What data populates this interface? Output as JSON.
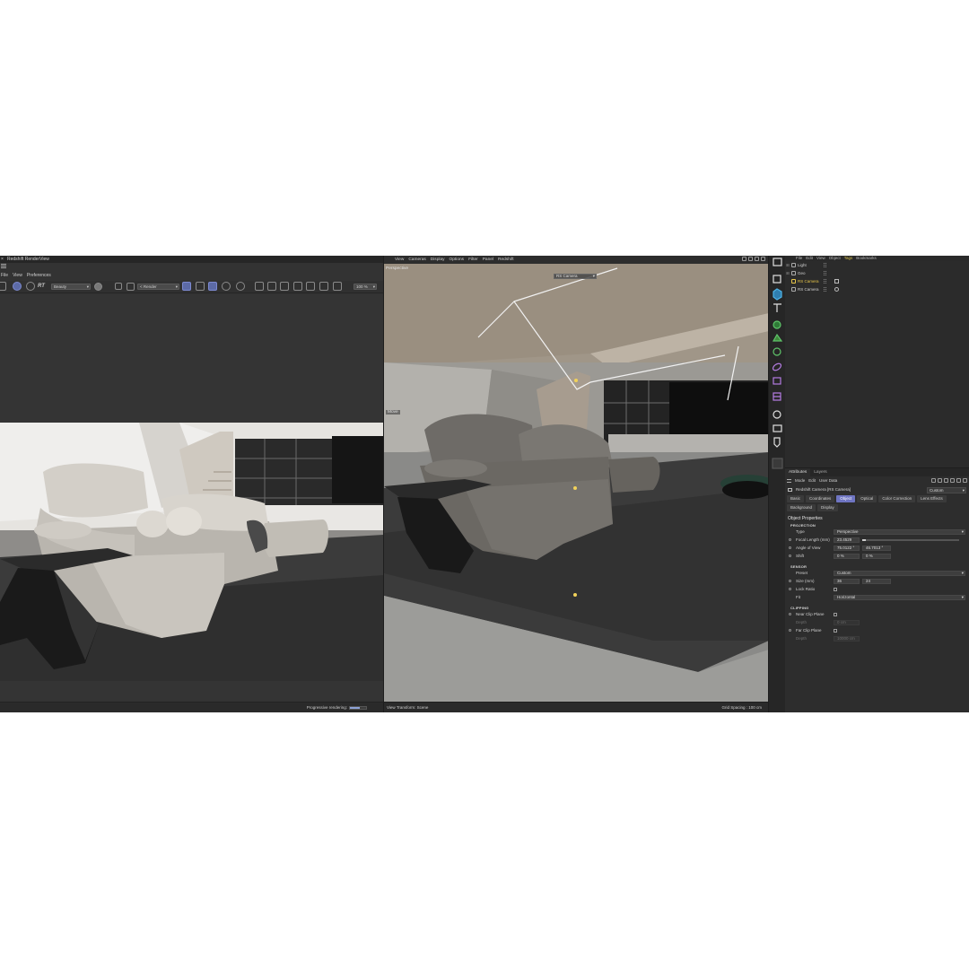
{
  "render_view": {
    "title": "Redshift RenderView",
    "close_glyph": "×",
    "menu": [
      "File",
      "View",
      "Preferences"
    ],
    "rt_label": "RT",
    "aov_dropdown": "Beauty",
    "camera_dropdown": "< Render",
    "zoom": "100 %",
    "status_label": "Progressive rendering:",
    "progress": 0.6,
    "progress_color": "#8da2d6"
  },
  "viewport": {
    "menu": [
      "View",
      "Cameras",
      "Display",
      "Options",
      "Filter",
      "Panel",
      "Redshift"
    ],
    "projection_label": "Perspective",
    "camera_dropdown": "RS Camera",
    "move_label": "Move",
    "status_left": "View Transform: Scene",
    "status_right": "Grid Spacing : 100 cm"
  },
  "object_manager": {
    "menu": [
      "File",
      "Edit",
      "View",
      "Object",
      "Tags",
      "Bookmarks"
    ],
    "highlight_item": "Tags",
    "objects": [
      {
        "name": "Light",
        "icon": "folder-icon",
        "selected": false
      },
      {
        "name": "Geo",
        "icon": "folder-icon",
        "selected": false
      },
      {
        "name": "RS Camera",
        "icon": "camera-icon",
        "selected": true
      },
      {
        "name": "RS Camera",
        "icon": "camera-icon",
        "selected": false
      }
    ]
  },
  "attributes": {
    "tabs": [
      "Attributes",
      "Layers"
    ],
    "active_tab": "Attributes",
    "menu": [
      "Mode",
      "Edit",
      "User Data"
    ],
    "object_title": "Redshift Camera [RS Camera]",
    "mode_dropdown": "Custom",
    "property_tabs": [
      "Basic",
      "Coordinates",
      "Object",
      "Optical",
      "Color Correction",
      "Lens Effects",
      "Background",
      "Display"
    ],
    "active_property_tab": "Object",
    "section_title": "Object Properties",
    "projection": {
      "header": "PROJECTION",
      "type_label": "Type",
      "type_value": "Perspective",
      "focal_label": "Focal Length (mm)",
      "focal_value": "23.4529",
      "aov_label": "Angle of View",
      "aov_h": "75.0122 °",
      "aov_v": "46.7013 °",
      "shift_label": "Shift",
      "shift_x": "0 %",
      "shift_y": "0 %"
    },
    "sensor": {
      "header": "SENSOR",
      "preset_label": "Preset",
      "preset_value": "Custom",
      "size_label": "Size (mm)",
      "size_w": "36",
      "size_h": "24",
      "lock_label": "Lock Ratio",
      "fit_label": "Fit",
      "fit_value": "Horizontal"
    },
    "clipping": {
      "header": "CLIPPING",
      "near_label": "Near Clip Plane",
      "near_depth_label": "Depth",
      "near_depth_value": "0 cm",
      "far_label": "Far Clip Plane",
      "far_depth_label": "Depth",
      "far_depth_value": "10000 cm"
    }
  },
  "colors": {
    "accent": "#6f75c2",
    "selection": "#e6c54a",
    "panel_bg": "#2c2c2c"
  }
}
